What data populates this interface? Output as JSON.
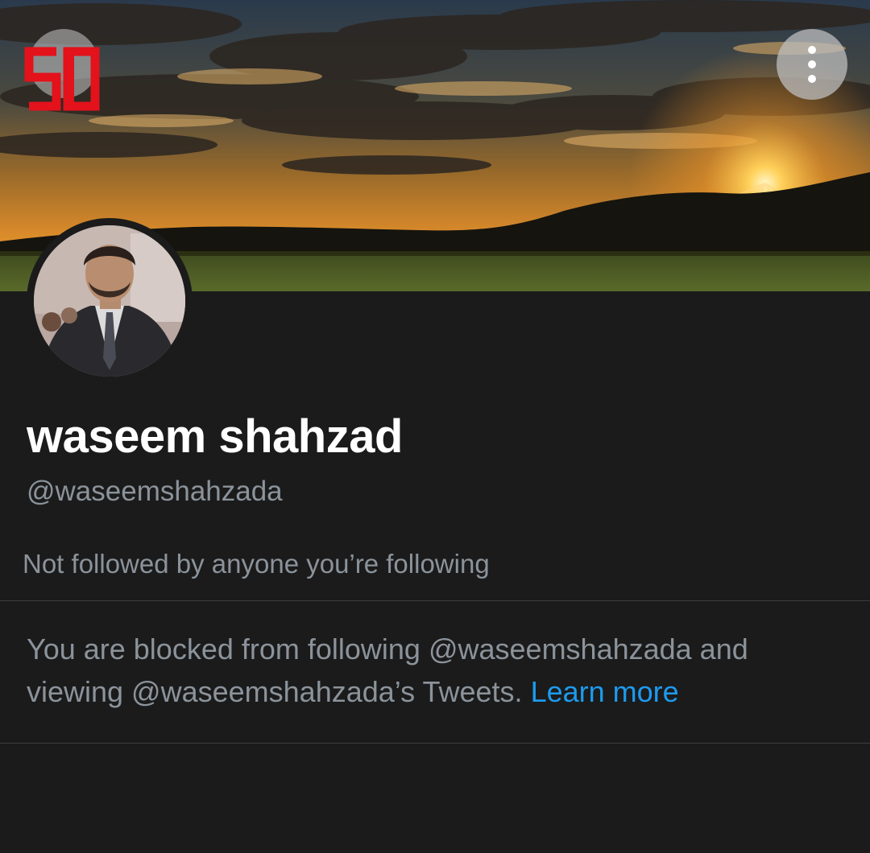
{
  "header": {
    "back_icon": "arrow-left-icon",
    "more_icon": "more-vertical-icon",
    "logo_text": "SD"
  },
  "profile": {
    "display_name": "waseem shahzad",
    "handle": "@waseemshahzada",
    "followers_you_know": "Not followed by anyone you’re following"
  },
  "blocked_notice": {
    "text": "You are blocked from following @waseemshahzada and viewing @waseemshahzada’s Tweets.",
    "link_label": "Learn more"
  },
  "colors": {
    "background": "#1b1b1b",
    "secondary_text": "#8b939b",
    "link": "#1d9bf0",
    "logo_red": "#e3121b"
  }
}
